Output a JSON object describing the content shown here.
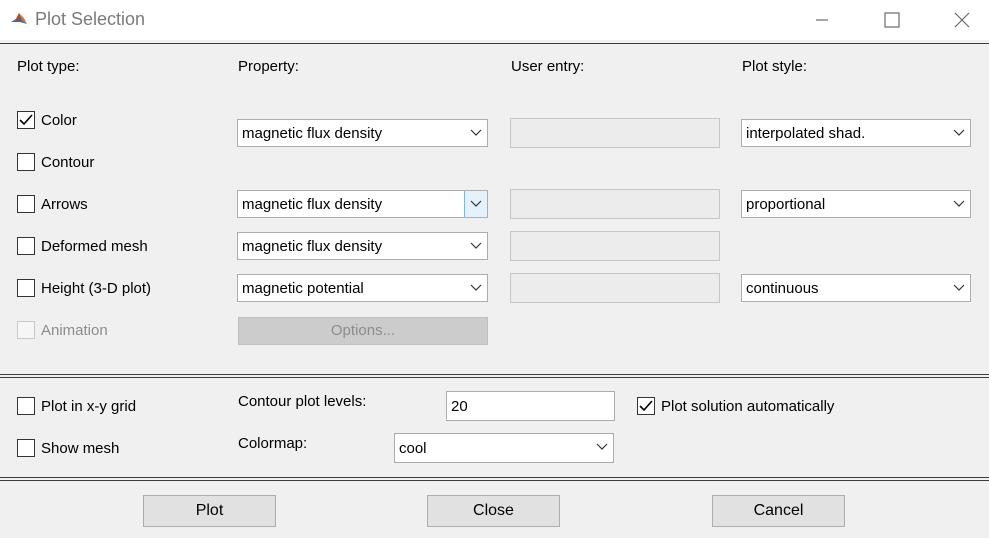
{
  "window": {
    "title": "Plot Selection",
    "icon": "matlab-logo-icon",
    "controls": [
      "minimize-icon",
      "maximize-icon",
      "close-icon"
    ]
  },
  "headers": {
    "plot_type": "Plot type:",
    "property": "Property:",
    "user_entry": "User entry:",
    "plot_style": "Plot style:"
  },
  "plot_types": [
    {
      "label": "Color",
      "checked": true
    },
    {
      "label": "Contour",
      "checked": false
    },
    {
      "label": "Arrows",
      "checked": false
    },
    {
      "label": "Deformed mesh",
      "checked": false
    },
    {
      "label": "Height (3-D plot)",
      "checked": false
    },
    {
      "label": "Animation",
      "checked": false,
      "enabled": false
    }
  ],
  "properties": {
    "color": "magnetic flux density",
    "arrows": "magnetic flux density",
    "deformed_mesh": "magnetic flux density",
    "height": "magnetic potential"
  },
  "plot_styles": {
    "color": "interpolated shad.",
    "arrows": "proportional",
    "height": "continuous"
  },
  "options_button": "Options...",
  "lower": {
    "plot_in_grid": {
      "label": "Plot in x-y grid",
      "checked": false
    },
    "show_mesh": {
      "label": "Show mesh",
      "checked": false
    },
    "contour_levels_label": "Contour plot levels:",
    "contour_levels_value": "20",
    "colormap_label": "Colormap:",
    "colormap_value": "cool",
    "plot_auto": {
      "label": "Plot solution automatically",
      "checked": true
    }
  },
  "buttons": {
    "plot": "Plot",
    "close": "Close",
    "cancel": "Cancel"
  }
}
